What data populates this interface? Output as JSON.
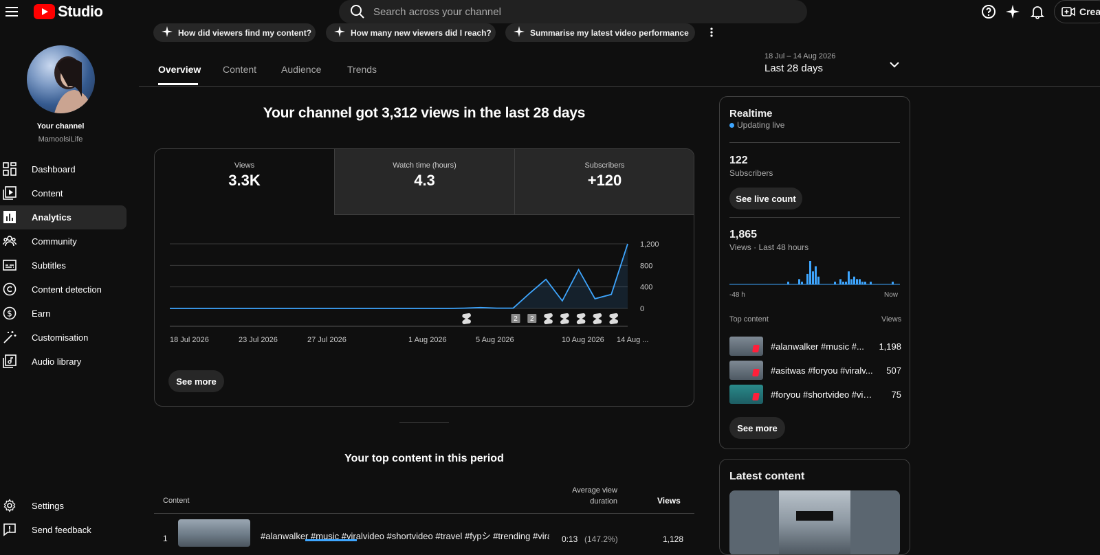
{
  "app": {
    "logo_text": "Studio",
    "search_placeholder": "Search across your channel",
    "create_label": "Creat"
  },
  "sidebar": {
    "channel_title": "Your channel",
    "channel_name": "MamoolsiLife",
    "items": [
      {
        "label": "Dashboard",
        "icon": "dashboard-icon"
      },
      {
        "label": "Content",
        "icon": "content-icon"
      },
      {
        "label": "Analytics",
        "icon": "analytics-icon",
        "active": true
      },
      {
        "label": "Community",
        "icon": "community-icon"
      },
      {
        "label": "Subtitles",
        "icon": "subtitles-icon"
      },
      {
        "label": "Content detection",
        "icon": "copyright-icon"
      },
      {
        "label": "Earn",
        "icon": "earn-icon"
      },
      {
        "label": "Customisation",
        "icon": "magic-wand-icon"
      },
      {
        "label": "Audio library",
        "icon": "audio-library-icon"
      }
    ],
    "settings_label": "Settings",
    "feedback_label": "Send feedback"
  },
  "chips": [
    "How did viewers find my content?",
    "How many new viewers did I reach?",
    "Summarise my latest video performance"
  ],
  "tabs": [
    "Overview",
    "Content",
    "Audience",
    "Trends"
  ],
  "date": {
    "range": "18 Jul – 14 Aug 2026",
    "label": "Last 28 days"
  },
  "headline": "Your channel got 3,312 views in the last 28 days",
  "metrics": [
    {
      "label": "Views",
      "value": "3.3K"
    },
    {
      "label": "Watch time (hours)",
      "value": "4.3"
    },
    {
      "label": "Subscribers",
      "value": "+120"
    }
  ],
  "chart_data": {
    "type": "line",
    "x_tick_labels": [
      "18 Jul 2026",
      "23 Jul 2026",
      "27 Jul 2026",
      "1 Aug 2026",
      "5 Aug 2026",
      "10 Aug 2026",
      "14 Aug ..."
    ],
    "y_ticks": [
      0,
      400,
      800,
      "1,200"
    ],
    "ylim": [
      0,
      1200
    ],
    "x": [
      "18 Jul",
      "19 Jul",
      "20 Jul",
      "21 Jul",
      "22 Jul",
      "23 Jul",
      "24 Jul",
      "25 Jul",
      "26 Jul",
      "27 Jul",
      "28 Jul",
      "29 Jul",
      "30 Jul",
      "31 Jul",
      "1 Aug",
      "2 Aug",
      "3 Aug",
      "4 Aug",
      "5 Aug",
      "6 Aug",
      "7 Aug",
      "8 Aug",
      "9 Aug",
      "10 Aug",
      "11 Aug",
      "12 Aug",
      "13 Aug",
      "14 Aug"
    ],
    "values": [
      0,
      0,
      0,
      0,
      0,
      0,
      0,
      0,
      0,
      0,
      0,
      0,
      0,
      0,
      0,
      0,
      0,
      0,
      5,
      15,
      5,
      5,
      280,
      540,
      140,
      720,
      180,
      260,
      1200
    ],
    "markers": [
      {
        "date": "5 Aug",
        "label": ""
      },
      {
        "date": "8 Aug",
        "label": "2"
      },
      {
        "date": "9 Aug",
        "label": "2"
      },
      {
        "date": "10 Aug",
        "label": ""
      },
      {
        "date": "11 Aug",
        "label": ""
      },
      {
        "date": "12 Aug",
        "label": ""
      },
      {
        "date": "13 Aug",
        "label": ""
      },
      {
        "date": "14 Aug",
        "label": ""
      }
    ],
    "grid": true,
    "line_color": "#3ea6ff"
  },
  "see_more_label": "See more",
  "top_content": {
    "title": "Your top content in this period",
    "col_content": "Content",
    "col_avd": "Average view duration",
    "col_views": "Views",
    "rows": [
      {
        "rank": "1",
        "title": "#alanwalker #music #viralvideo #shortvideo #travel #fypシ #trending #vira...",
        "avd": "0:13",
        "avd_pct": "(147.2%)",
        "views": "1,128"
      }
    ]
  },
  "realtime": {
    "title": "Realtime",
    "status": "Updating live",
    "subs_value": "122",
    "subs_label": "Subscribers",
    "see_live_label": "See live count",
    "views_value": "1,865",
    "views_label": "Views · Last 48 hours",
    "axis_start": "-48 h",
    "axis_end": "Now",
    "bars": [
      0,
      0,
      0,
      0,
      0,
      0,
      0,
      0,
      0,
      0,
      0,
      0,
      0,
      0,
      0,
      0,
      0,
      0,
      0,
      0,
      0,
      1,
      0,
      0,
      0,
      2,
      1,
      0,
      4,
      9,
      5,
      7,
      3,
      0,
      0,
      0,
      0,
      0,
      1,
      0,
      2,
      1,
      1,
      5,
      2,
      3,
      2,
      2,
      1,
      1,
      0,
      1,
      0,
      0,
      0,
      0,
      0,
      0,
      0,
      1,
      0,
      0
    ],
    "top_content_label": "Top content",
    "top_views_label": "Views",
    "top_items": [
      {
        "title": "#alanwalker #music #...",
        "views": "1,198"
      },
      {
        "title": "#asitwas #foryou #viralv...",
        "views": "507"
      },
      {
        "title": "#foryou #shortvideo #vira...",
        "views": "75"
      }
    ],
    "see_more_label": "See more"
  },
  "latest": {
    "title": "Latest content"
  }
}
